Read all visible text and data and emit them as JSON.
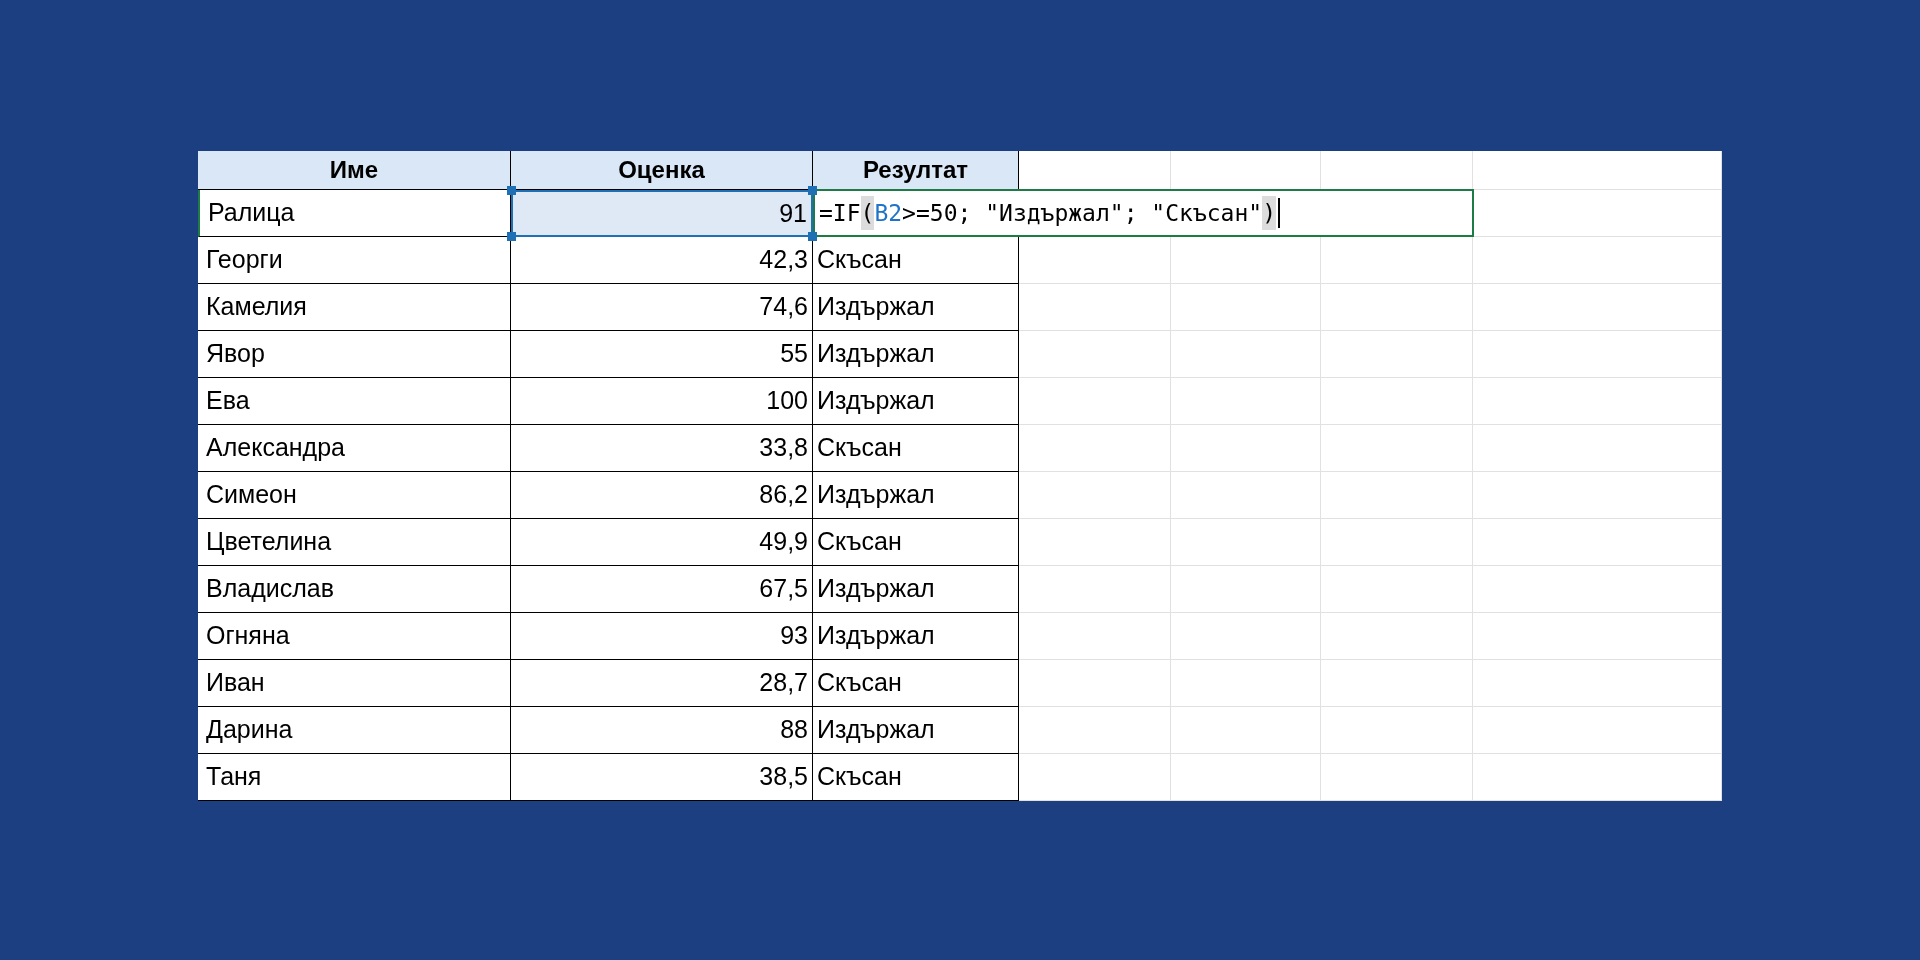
{
  "table": {
    "columns": [
      "Име",
      "Оценка",
      "Резултат"
    ],
    "rows": [
      {
        "name": "Ралица",
        "score": "91",
        "selected": true,
        "formula": [
          {
            "kind": "plain",
            "text": "=IF"
          },
          {
            "kind": "paren",
            "text": "("
          },
          {
            "kind": "ref",
            "text": "B2"
          },
          {
            "kind": "plain",
            "text": ">=50; \"Издържал\"; \"Скъсан\""
          },
          {
            "kind": "paren",
            "text": ")"
          }
        ]
      },
      {
        "name": "Георги",
        "score": "42,3",
        "result": "Скъсан",
        "selected": false
      },
      {
        "name": "Камелия",
        "score": "74,6",
        "result": "Издържал",
        "selected": false
      },
      {
        "name": "Явор",
        "score": "55",
        "result": "Издържал",
        "selected": false
      },
      {
        "name": "Ева",
        "score": "100",
        "result": "Издържал",
        "selected": false
      },
      {
        "name": "Александра",
        "score": "33,8",
        "result": "Скъсан",
        "selected": false
      },
      {
        "name": "Симеон",
        "score": "86,2",
        "result": "Издържал",
        "selected": false
      },
      {
        "name": "Цветелина",
        "score": "49,9",
        "result": "Скъсан",
        "selected": false
      },
      {
        "name": "Владислав",
        "score": "67,5",
        "result": "Издържал",
        "selected": false
      },
      {
        "name": "Огняна",
        "score": "93",
        "result": "Издържал",
        "selected": false
      },
      {
        "name": "Иван",
        "score": "28,7",
        "result": "Скъсан",
        "selected": false
      },
      {
        "name": "Дарина",
        "score": "88",
        "result": "Издържал",
        "selected": false
      },
      {
        "name": "Таня",
        "score": "38,5",
        "result": "Скъсан",
        "selected": false
      }
    ]
  }
}
